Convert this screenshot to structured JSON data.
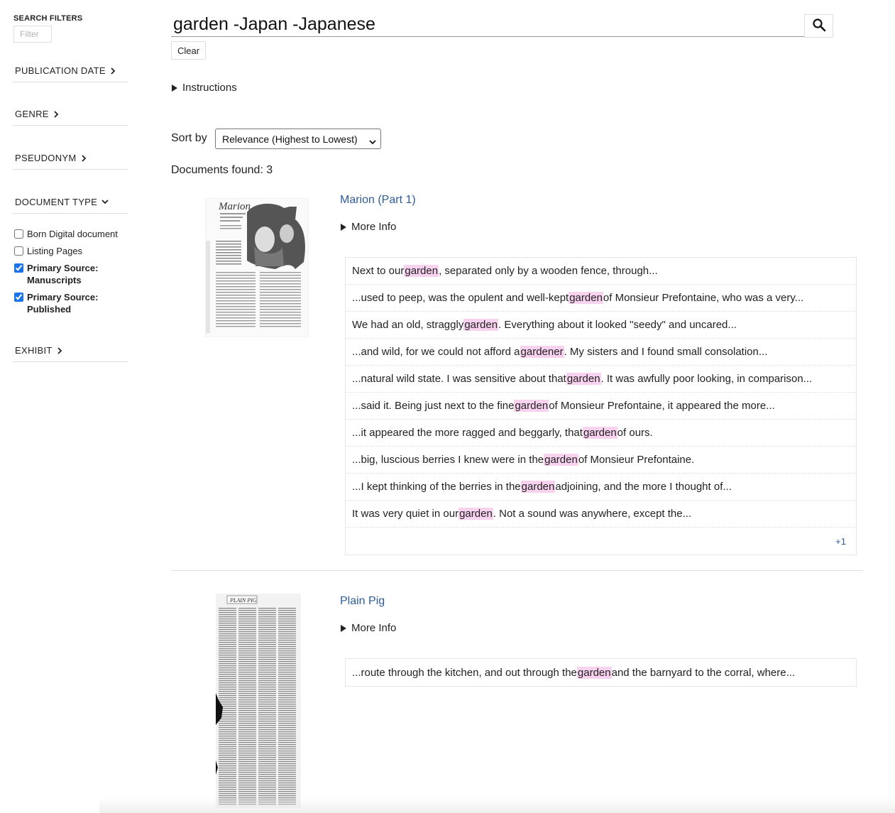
{
  "sidebar": {
    "title": "SEARCH FILTERS",
    "filter_placeholder": "Filter",
    "sections": {
      "publication_date": "PUBLICATION DATE",
      "genre": "GENRE",
      "pseudonym": "PSEUDONYM",
      "document_type": "DOCUMENT TYPE",
      "exhibit": "EXHIBIT"
    },
    "document_types": [
      {
        "label": "Born Digital document",
        "checked": false
      },
      {
        "label": "Listing Pages",
        "checked": false
      },
      {
        "label": "Primary Source: Manuscripts",
        "checked": true
      },
      {
        "label": "Primary Source: Published",
        "checked": true
      }
    ]
  },
  "search": {
    "query": "garden -Japan -Japanese",
    "clear_label": "Clear",
    "button_icon": "search-icon"
  },
  "instructions_label": "Instructions",
  "sort": {
    "label": "Sort by",
    "selected": "Relevance (Highest to Lowest)"
  },
  "documents_found": "Documents found: 3",
  "highlight_color": "#f9d2f0",
  "link_color": "#2e5c9a",
  "results": [
    {
      "title": "Marion (Part 1)",
      "more_info": "More Info",
      "snippets": [
        {
          "pre": "Next to our ",
          "hit": "garden",
          "post": ", separated only by a wooden fence, through..."
        },
        {
          "pre": "...used to peep, was the opulent and well-kept ",
          "hit": "garden",
          "post": " of Monsieur Prefontaine, who was a very..."
        },
        {
          "pre": "We had an old, straggly ",
          "hit": "garden",
          "post": ". Everything about it looked \"seedy\" and uncared..."
        },
        {
          "pre": "...and wild, for we could not afford a ",
          "hit": "gardener",
          "post": ". My sisters and I found small consolation..."
        },
        {
          "pre": "...natural wild state. I was sensitive about that ",
          "hit": "garden",
          "post": ". It was awfully poor looking, in comparison..."
        },
        {
          "pre": "...said it. Being just next to the fine ",
          "hit": "garden",
          "post": " of Monsieur Prefontaine, it appeared the more..."
        },
        {
          "pre": "...it appeared the more ragged and beggarly, that ",
          "hit": "garden",
          "post": " of ours."
        },
        {
          "pre": "...big, luscious berries I knew were in the ",
          "hit": "garden",
          "post": " of Monsieur Prefontaine."
        },
        {
          "pre": "...I kept thinking of the berries in the ",
          "hit": "garden",
          "post": " adjoining, and the more I thought of..."
        },
        {
          "pre": "It was very quiet in our ",
          "hit": "garden",
          "post": ". Not a sound was anywhere, except the..."
        }
      ],
      "more_count": "+1",
      "thumb_title": "Marion"
    },
    {
      "title": "Plain Pig",
      "more_info": "More Info",
      "snippets": [
        {
          "pre": "...route through the kitchen, and out through the ",
          "hit": "garden",
          "post": " and the barnyard to the corral, where..."
        }
      ],
      "thumb_title": "PLAIN PIG"
    }
  ]
}
